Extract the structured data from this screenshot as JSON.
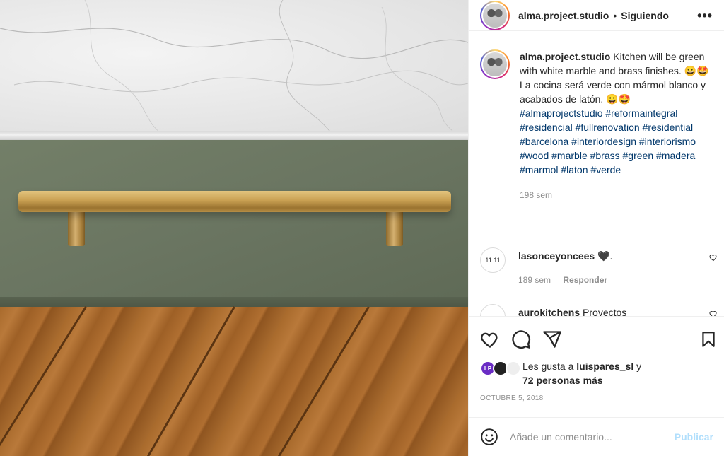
{
  "post": {
    "username": "alma.project.studio",
    "follow_status": "Siguiendo",
    "more": "•••"
  },
  "caption": {
    "username": "alma.project.studio",
    "text_en": "Kitchen will be green with white marble and brass finishes. 😀🤩",
    "text_es": "La cocina será verde con mármol blanco y acabados de latón. 😀🤩",
    "hashtags": "#almaprojectstudio #reformaintegral #residencial #fullrenovation #residential #barcelona #interiordesign #interiorismo #wood #marble #brass #green #madera #marmol #laton #verde",
    "time": "198 sem"
  },
  "comments": [
    {
      "username": "lasonceyoncees",
      "text": "🖤.",
      "avatar": "11:11",
      "time": "189 sem",
      "reply": "Responder"
    },
    {
      "username": "aurokitchens",
      "text": "Proyectos",
      "avatar": ""
    }
  ],
  "likes": {
    "prefix": "Les gusta a",
    "user": "luispares_sl",
    "and": "y",
    "others": "72 personas más",
    "avatar_labels": [
      "LP",
      "",
      ""
    ]
  },
  "date": "OCTUBRE 5, 2018",
  "add_comment": {
    "placeholder": "Añade un comentario...",
    "publish": "Publicar"
  },
  "icons": {
    "like": "heart-icon",
    "comment": "comment-icon",
    "share": "share-icon",
    "save": "bookmark-icon",
    "emoji": "emoji-icon"
  }
}
